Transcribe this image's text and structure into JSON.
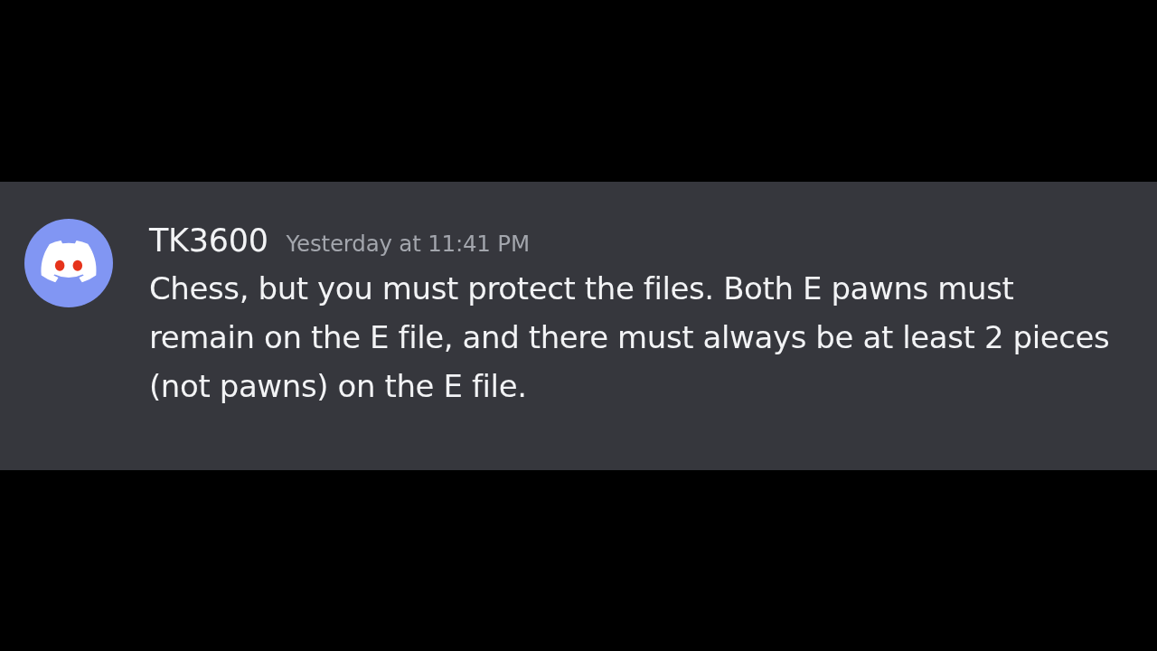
{
  "message": {
    "author": "TK3600",
    "timestamp": "Yesterday at 11:41 PM",
    "text": "Chess, but you must protect the files. Both E pawns must remain on the E file, and there must always be at least 2 pieces (not pawns) on the E file."
  }
}
